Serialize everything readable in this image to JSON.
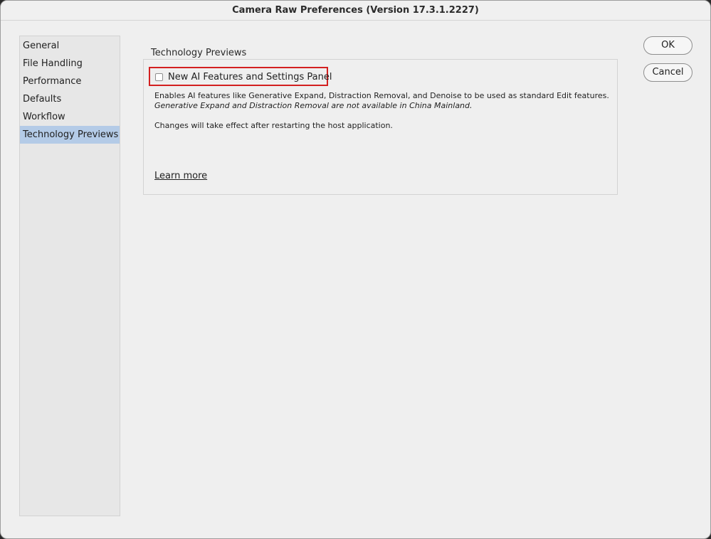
{
  "window": {
    "title": "Camera Raw Preferences  (Version 17.3.1.2227)"
  },
  "sidebar": {
    "items": [
      {
        "label": "General"
      },
      {
        "label": "File Handling"
      },
      {
        "label": "Performance"
      },
      {
        "label": "Defaults"
      },
      {
        "label": "Workflow"
      },
      {
        "label": "Technology Previews",
        "selected": true
      }
    ]
  },
  "panel": {
    "group_title": "Technology Previews",
    "checkbox": {
      "label": "New AI Features and Settings Panel",
      "checked": false
    },
    "description_line1": "Enables AI features like Generative Expand, Distraction Removal, and Denoise to be used as standard Edit features.",
    "description_line2": "Generative Expand and Distraction Removal are not available in China Mainland.",
    "restart_note": "Changes will take effect after restarting the host application.",
    "learn_more": "Learn more"
  },
  "buttons": {
    "ok": "OK",
    "cancel": "Cancel"
  },
  "colors": {
    "selection": "#b4cbe7",
    "highlight_border": "#d32020"
  }
}
